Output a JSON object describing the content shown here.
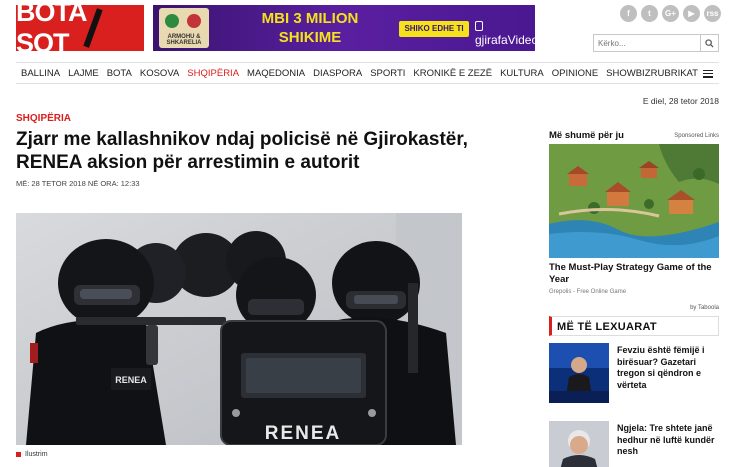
{
  "header": {
    "logo_text": "BOTA SOT",
    "banner": {
      "cartoon_caption": "ARMOHU & SHKARELIA",
      "headline_line1": "MBI 3 MILION",
      "headline_line2": "SHIKIME",
      "cta": "SHIKO EDHE TI",
      "brand": "gjirafaVideo"
    },
    "social": [
      "f",
      "t",
      "G+",
      "▶",
      "rss"
    ],
    "search_placeholder": "Kërko..."
  },
  "nav": {
    "items": [
      {
        "label": "BALLINA"
      },
      {
        "label": "LAJME"
      },
      {
        "label": "BOTA"
      },
      {
        "label": "KOSOVA"
      },
      {
        "label": "SHQIPËRIA"
      },
      {
        "label": "MAQEDONIA"
      },
      {
        "label": "DIASPORA"
      },
      {
        "label": "SPORTI"
      },
      {
        "label": "KRONIKË E ZEZË"
      },
      {
        "label": "KULTURA"
      },
      {
        "label": "OPINIONE"
      },
      {
        "label": "SHOWBIZ"
      }
    ],
    "active_index": 4,
    "rubrikat": "RUBRIKAT"
  },
  "date": "E diel, 28 tetor 2018",
  "article": {
    "category": "SHQIPËRIA",
    "title": "Zjarr me kallashnikov ndaj policisë në Gjirokastër, RENEA aksion për arrestimin e autorit",
    "meta": "MË: 28 TETOR 2018 NË ORA: 12:33",
    "caption": "Ilustrim",
    "photo_labels": {
      "shield": "RENEA",
      "patch": "RENEA"
    }
  },
  "sidebar": {
    "heading": "Më shumë për ju",
    "sponsored": "Sponsored Links",
    "ad_title": "The Must-Play Strategy Game of the Year",
    "ad_source": "Grepolis - Free Online Game",
    "taboola": "by Taboola",
    "most_read_title": "MË TË LEXUARAT",
    "most_read": [
      {
        "title": "Fevziu është fëmijë i birësuar? Gazetari tregon si qëndron e vërteta"
      },
      {
        "title": "Ngjela: Tre shtete janë hedhur në luftë kundër nesh"
      }
    ]
  },
  "colors": {
    "brand_red": "#d9201f",
    "banner_purple": "#4a1890",
    "banner_yellow": "#f5e21b"
  }
}
